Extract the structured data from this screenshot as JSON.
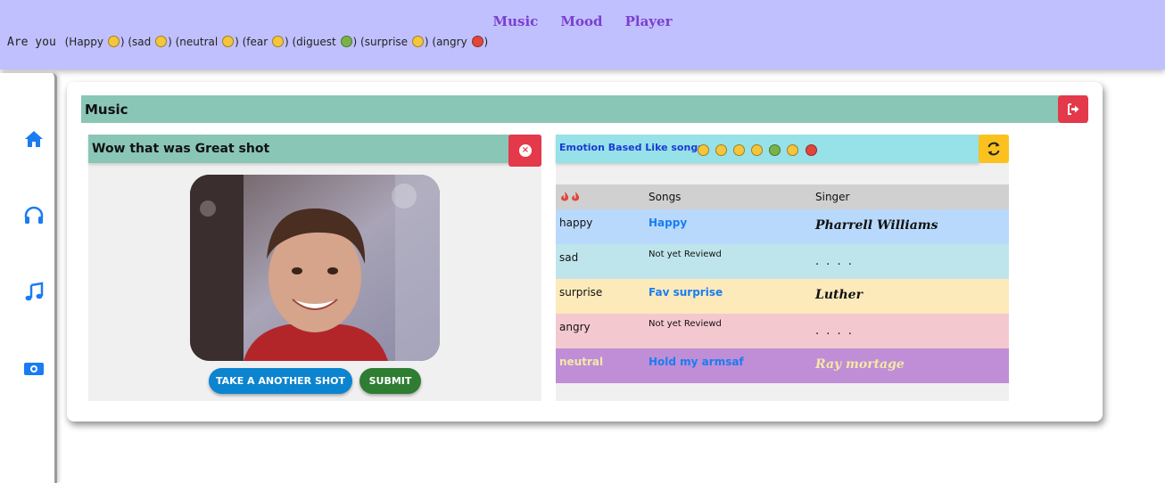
{
  "nav": {
    "items": [
      "Music",
      "Mood",
      "Player"
    ]
  },
  "mood_line": {
    "lead": "Are you",
    "items": [
      {
        "label": "(Happy",
        "icon": "happy-emoji",
        "tone": "yellow"
      },
      {
        "label": "(sad",
        "icon": "sad-emoji",
        "tone": "yellow"
      },
      {
        "label": "(neutral",
        "icon": "neutral-emoji",
        "tone": "yellow"
      },
      {
        "label": "(fear",
        "icon": "fear-emoji",
        "tone": "yellow"
      },
      {
        "label": "(diguest",
        "icon": "disgust-emoji",
        "tone": "green"
      },
      {
        "label": "(surprise",
        "icon": "surprise-emoji",
        "tone": "yellow"
      },
      {
        "label": "(angry",
        "icon": "angry-emoji",
        "tone": "red"
      }
    ]
  },
  "sidebar": {
    "icons": [
      "home-icon",
      "headphones-icon",
      "music-note-icon",
      "money-icon"
    ]
  },
  "music_panel": {
    "title": "Music"
  },
  "shot_panel": {
    "title": "Wow that was Great shot",
    "take_another_label": "TAKE A ANOTHER SHOT",
    "submit_label": "SUBMIT"
  },
  "emotion_panel": {
    "title": "Emotion Based Like songs",
    "columns": [
      "Songs",
      "Singer"
    ],
    "rows": [
      {
        "emotion": "happy",
        "song": "Happy",
        "song_style": "link",
        "singer": "Pharrell Williams",
        "bg": "#b8d9fc",
        "emotion_color": "#111111"
      },
      {
        "emotion": "sad",
        "song": "Not yet Reviewd",
        "song_style": "small",
        "singer": ". . . .",
        "bg": "#bfe5ec",
        "emotion_color": "#111111"
      },
      {
        "emotion": "surprise",
        "song": "Fav surprise",
        "song_style": "link",
        "singer": "Luther",
        "bg": "#fdeabb",
        "emotion_color": "#111111"
      },
      {
        "emotion": "angry",
        "song": "Not yet Reviewd",
        "song_style": "small",
        "singer": ". . . .",
        "bg": "#f4c8cf",
        "emotion_color": "#111111"
      },
      {
        "emotion": "neutral",
        "song": "Hold my armsaf",
        "song_style": "link",
        "singer": "Ray mortage",
        "bg": "#bf8ed6",
        "emotion_color": "#f6e7a6"
      }
    ]
  },
  "colors": {
    "accent_green": "#8ac6b6",
    "danger": "#e3394b",
    "link": "#1a7cf2",
    "nav_bg": "#c0c0fe"
  }
}
